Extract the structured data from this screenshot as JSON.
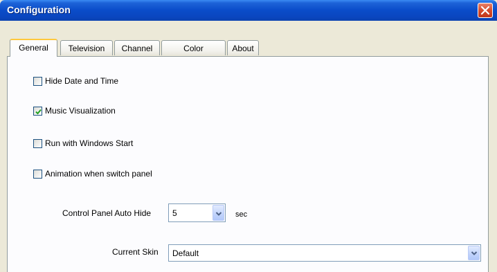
{
  "window": {
    "title": "Configuration"
  },
  "tabs": [
    {
      "label": "General",
      "active": true
    },
    {
      "label": "Television",
      "active": false
    },
    {
      "label": "Channel",
      "active": false
    },
    {
      "label": "Color",
      "active": false
    },
    {
      "label": "About",
      "active": false
    }
  ],
  "options": [
    {
      "label": "Hide Date and Time",
      "checked": false
    },
    {
      "label": "Music Visualization",
      "checked": true
    },
    {
      "label": "Run with Windows Start",
      "checked": false
    },
    {
      "label": "Animation when switch panel",
      "checked": false
    }
  ],
  "auto_hide": {
    "label": "Control Panel Auto Hide",
    "value": "5",
    "unit": "sec"
  },
  "skin": {
    "label": "Current Skin",
    "value": "Default"
  },
  "colors": {
    "title_bar": "#0A4CC9",
    "close": "#D54C2C",
    "check": "#21A121",
    "tab_highlight": "#FFC83C"
  }
}
